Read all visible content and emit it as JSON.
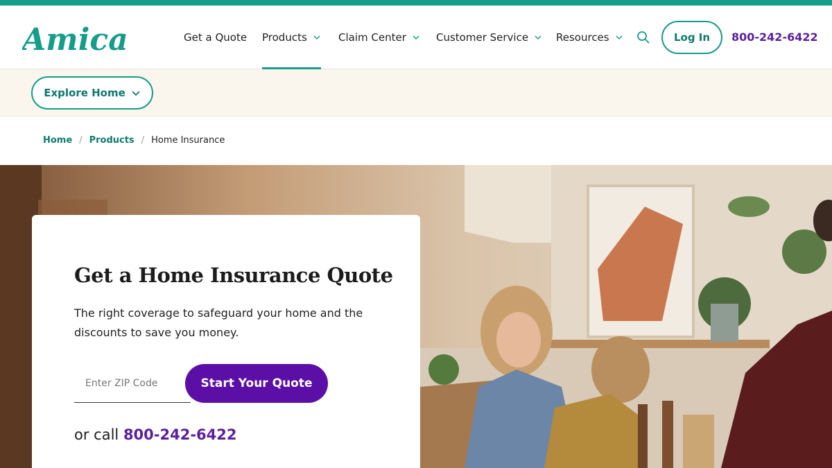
{
  "brand": {
    "logo_text": "Amica",
    "colors": {
      "teal": "#159d8a",
      "purple": "#5b0fa6",
      "cream": "#faf6ee"
    }
  },
  "nav": {
    "items": [
      {
        "label": "Get a Quote",
        "has_dropdown": false
      },
      {
        "label": "Products",
        "has_dropdown": true,
        "active": true
      },
      {
        "label": "Claim Center",
        "has_dropdown": true
      },
      {
        "label": "Customer Service",
        "has_dropdown": true
      },
      {
        "label": "Resources",
        "has_dropdown": true
      }
    ],
    "search_icon": "search-icon",
    "login_label": "Log In",
    "phone": "800-242-6422"
  },
  "subnav": {
    "explore_label": "Explore Home"
  },
  "breadcrumb": {
    "items": [
      "Home",
      "Products"
    ],
    "current": "Home Insurance"
  },
  "hero": {
    "card": {
      "title": "Get a Home Insurance Quote",
      "description": "The right coverage to safeguard your home and the discounts to save you money.",
      "zip_placeholder": "Enter ZIP Code",
      "zip_value": "",
      "cta_label": "Start Your Quote",
      "call_prefix": "or call",
      "call_phone": "800-242-6422"
    }
  }
}
